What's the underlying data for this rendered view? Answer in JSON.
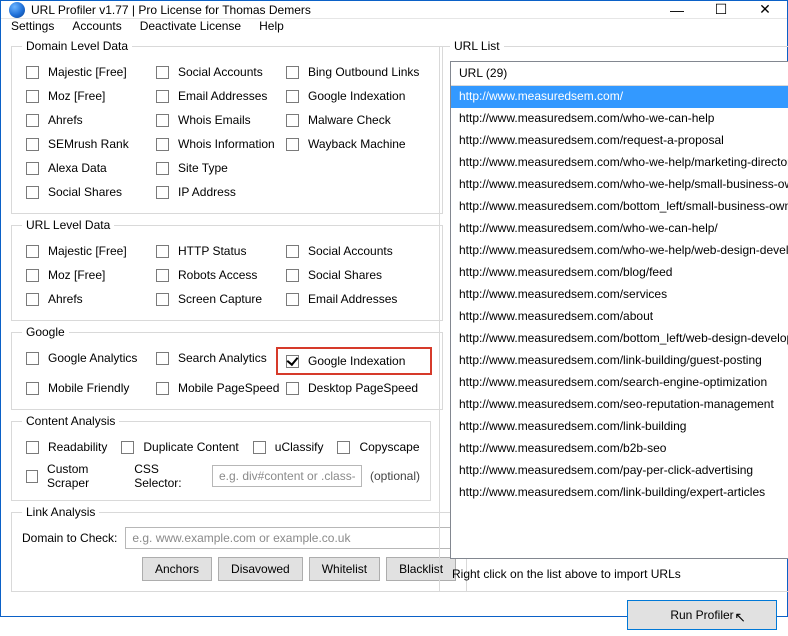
{
  "window": {
    "title": "URL Profiler v1.77 | Pro License for Thomas Demers"
  },
  "menu": {
    "settings": "Settings",
    "accounts": "Accounts",
    "deactivate": "Deactivate License",
    "help": "Help"
  },
  "groups": {
    "domain": "Domain Level Data",
    "url": "URL Level Data",
    "google": "Google",
    "content": "Content Analysis",
    "link": "Link Analysis",
    "urllist": "URL List"
  },
  "domain": {
    "majestic": "Majestic [Free]",
    "social_accounts": "Social Accounts",
    "bing_outbound": "Bing Outbound Links",
    "moz": "Moz [Free]",
    "email_addresses": "Email Addresses",
    "google_indexation": "Google Indexation",
    "ahrefs": "Ahrefs",
    "whois_emails": "Whois Emails",
    "malware": "Malware Check",
    "semrush": "SEMrush Rank",
    "whois_info": "Whois Information",
    "wayback": "Wayback Machine",
    "alexa": "Alexa Data",
    "site_type": "Site Type",
    "social_shares": "Social Shares",
    "ip_address": "IP Address"
  },
  "url": {
    "majestic": "Majestic [Free]",
    "http_status": "HTTP Status",
    "social_accounts": "Social Accounts",
    "moz": "Moz [Free]",
    "robots": "Robots Access",
    "social_shares": "Social Shares",
    "ahrefs": "Ahrefs",
    "screen_capture": "Screen Capture",
    "email_addresses": "Email Addresses"
  },
  "google": {
    "analytics": "Google Analytics",
    "search_analytics": "Search Analytics",
    "indexation": "Google Indexation",
    "mobile_friendly": "Mobile Friendly",
    "mobile_pagespeed": "Mobile PageSpeed",
    "desktop_pagespeed": "Desktop PageSpeed"
  },
  "contentA": {
    "readability": "Readability",
    "duplicate": "Duplicate Content",
    "uclassify": "uClassify",
    "copyscape": "Copyscape",
    "custom_scraper": "Custom Scraper",
    "css_label": "CSS Selector:",
    "css_placeholder": "e.g. div#content or .class-na",
    "optional": "(optional)"
  },
  "link": {
    "domain_label": "Domain to Check:",
    "placeholder": "e.g. www.example.com or example.co.uk",
    "anchors": "Anchors",
    "disavowed": "Disavowed",
    "whitelist": "Whitelist",
    "blacklist": "Blacklist"
  },
  "list": {
    "header": "URL (29)",
    "hint": "Right click on the list above to import URLs",
    "urls": [
      "http://www.measuredsem.com/",
      "http://www.measuredsem.com/who-we-can-help",
      "http://www.measuredsem.com/request-a-proposal",
      "http://www.measuredsem.com/who-we-help/marketing-directors",
      "http://www.measuredsem.com/who-we-help/small-business-own",
      "http://www.measuredsem.com/bottom_left/small-business-owne",
      "http://www.measuredsem.com/who-we-can-help/",
      "http://www.measuredsem.com/who-we-help/web-design-develo",
      "http://www.measuredsem.com/blog/feed",
      "http://www.measuredsem.com/services",
      "http://www.measuredsem.com/about",
      "http://www.measuredsem.com/bottom_left/web-design-developm",
      "http://www.measuredsem.com/link-building/guest-posting",
      "http://www.measuredsem.com/search-engine-optimization",
      "http://www.measuredsem.com/seo-reputation-management",
      "http://www.measuredsem.com/link-building",
      "http://www.measuredsem.com/b2b-seo",
      "http://www.measuredsem.com/pay-per-click-advertising",
      "http://www.measuredsem.com/link-building/expert-articles"
    ]
  },
  "run": "Run Profiler"
}
